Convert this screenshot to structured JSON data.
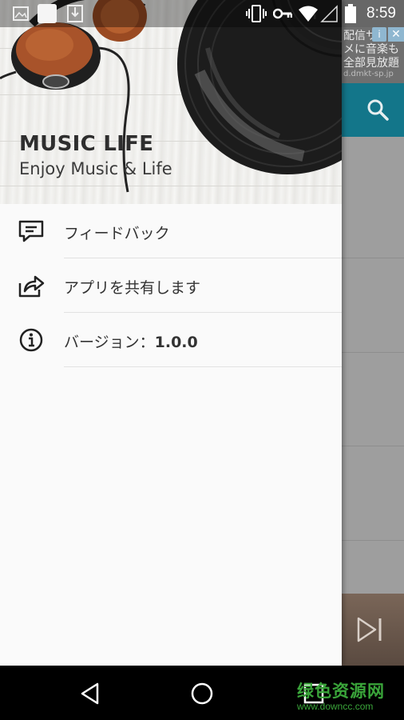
{
  "status_bar": {
    "time": "8:59",
    "icons": [
      "image-icon",
      "notification-square-icon",
      "download-icon",
      "vibrate-icon",
      "vpn-key-icon",
      "wifi-icon",
      "signal-icon",
      "battery-icon"
    ]
  },
  "drawer": {
    "header": {
      "app_name": "MUSIC LIFE",
      "tagline": "Enjoy Music & Life"
    },
    "menu": [
      {
        "icon": "feedback-icon",
        "label": "フィードバック"
      },
      {
        "icon": "share-icon",
        "label": "アプリを共有します"
      },
      {
        "icon": "info-icon",
        "label_prefix": "バージョン：",
        "version": "1.0.0"
      }
    ]
  },
  "background_app": {
    "ad_lines": [
      "配信サ",
      "メに音楽も",
      "全部見放題",
      "d.dmkt-sp.jp"
    ],
    "toolbar_icon": "search-icon",
    "player_icon": "skip-next-icon"
  },
  "nav_bar": {
    "buttons": [
      "back-icon",
      "home-icon",
      "recents-icon"
    ]
  },
  "watermark": {
    "cn": "绿色资源网",
    "url": "www.downcc.com"
  },
  "colors": {
    "toolbar": "#13768a",
    "drawer_bg": "#fafafa",
    "text": "#333333"
  }
}
